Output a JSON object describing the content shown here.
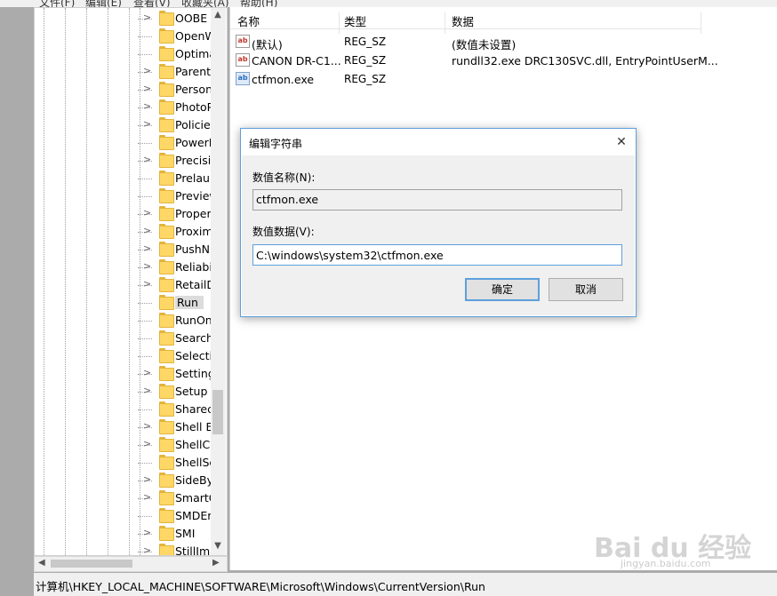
{
  "menubar": [
    "文件(F)",
    "编辑(E)",
    "查看(V)",
    "收藏夹(A)",
    "帮助(H)"
  ],
  "tree": {
    "items": [
      {
        "label": "OOBE",
        "expandable": true
      },
      {
        "label": "OpenW",
        "expandable": false
      },
      {
        "label": "Optima",
        "expandable": false
      },
      {
        "label": "Parent",
        "expandable": true
      },
      {
        "label": "Person",
        "expandable": true
      },
      {
        "label": "PhotoP",
        "expandable": true
      },
      {
        "label": "Policie",
        "expandable": true
      },
      {
        "label": "PowerI",
        "expandable": false
      },
      {
        "label": "Precisi",
        "expandable": true
      },
      {
        "label": "Prelaun",
        "expandable": false
      },
      {
        "label": "Preview",
        "expandable": false
      },
      {
        "label": "Proper",
        "expandable": true
      },
      {
        "label": "Proxim",
        "expandable": true
      },
      {
        "label": "PushN",
        "expandable": true
      },
      {
        "label": "Reliabi",
        "expandable": true
      },
      {
        "label": "RetailD",
        "expandable": true
      },
      {
        "label": "Run",
        "expandable": false,
        "selected": true
      },
      {
        "label": "RunOn",
        "expandable": false
      },
      {
        "label": "Search",
        "expandable": false
      },
      {
        "label": "Selecti",
        "expandable": false
      },
      {
        "label": "Setting",
        "expandable": true
      },
      {
        "label": "Setup",
        "expandable": true
      },
      {
        "label": "Sharec",
        "expandable": false
      },
      {
        "label": "Shell E",
        "expandable": true
      },
      {
        "label": "ShellCo",
        "expandable": true
      },
      {
        "label": "ShellSe",
        "expandable": false
      },
      {
        "label": "SideBy",
        "expandable": true
      },
      {
        "label": "SmartG",
        "expandable": true
      },
      {
        "label": "SMDEr",
        "expandable": false
      },
      {
        "label": "SMI",
        "expandable": true
      },
      {
        "label": "StillIma",
        "expandable": true
      }
    ]
  },
  "list": {
    "headers": {
      "name": "名称",
      "type": "类型",
      "data": "数据"
    },
    "rows": [
      {
        "icon": "ab",
        "name": "(默认)",
        "type": "REG_SZ",
        "data": "(数值未设置)"
      },
      {
        "icon": "ab",
        "name": "CANON DR-C1...",
        "type": "REG_SZ",
        "data": "rundll32.exe DRC130SVC.dll, EntryPointUserM..."
      },
      {
        "icon": "ab-blue",
        "name": "ctfmon.exe",
        "type": "REG_SZ",
        "data": ""
      }
    ]
  },
  "dialog": {
    "title": "编辑字符串",
    "name_label": "数值名称(N):",
    "name_value": "ctfmon.exe",
    "data_label": "数值数据(V):",
    "data_value": "C:\\windows\\system32\\ctfmon.exe",
    "ok_label": "确定",
    "cancel_label": "取消",
    "close_glyph": "✕"
  },
  "status": {
    "path": "计算机\\HKEY_LOCAL_MACHINE\\SOFTWARE\\Microsoft\\Windows\\CurrentVersion\\Run"
  },
  "watermark": {
    "logo": "Bai du 经验",
    "url": "jingyan.baidu.com"
  }
}
